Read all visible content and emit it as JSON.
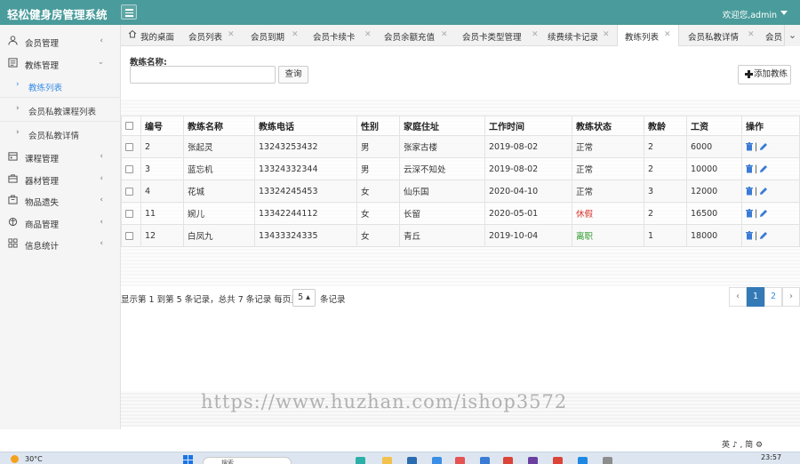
{
  "app": {
    "title": "轻松健身房管理系统",
    "welcome": "欢迎您,admin"
  },
  "sidebar": {
    "items": [
      {
        "label": "会员管理",
        "icon": "user-icon",
        "expanded": false
      },
      {
        "label": "教练管理",
        "icon": "document-icon",
        "expanded": true
      },
      {
        "label": "课程管理",
        "icon": "calendar-icon",
        "expanded": false
      },
      {
        "label": "器材管理",
        "icon": "briefcase-icon",
        "expanded": false
      },
      {
        "label": "物品遗失",
        "icon": "box-icon",
        "expanded": false
      },
      {
        "label": "商品管理",
        "icon": "gift-icon",
        "expanded": false
      },
      {
        "label": "信息统计",
        "icon": "grid-icon",
        "expanded": false
      }
    ],
    "sub_items": [
      {
        "label": "教练列表",
        "active": true
      },
      {
        "label": "会员私教课程列表",
        "active": false
      },
      {
        "label": "会员私教详情",
        "active": false
      }
    ]
  },
  "tabs": [
    {
      "label": "我的桌面",
      "closable": false,
      "active": false
    },
    {
      "label": "会员列表",
      "closable": true,
      "active": false
    },
    {
      "label": "会员到期",
      "closable": true,
      "active": false
    },
    {
      "label": "会员卡续卡",
      "closable": true,
      "active": false
    },
    {
      "label": "会员余额充值",
      "closable": true,
      "active": false
    },
    {
      "label": "会员卡类型管理",
      "closable": true,
      "active": false
    },
    {
      "label": "续费续卡记录",
      "closable": true,
      "active": false
    },
    {
      "label": "教练列表",
      "closable": true,
      "active": true
    },
    {
      "label": "会员私教详情",
      "closable": true,
      "active": false
    },
    {
      "label": "会员",
      "closable": false,
      "active": false
    }
  ],
  "search": {
    "label": "教练名称:",
    "value": "",
    "placeholder": "",
    "button": "查询"
  },
  "add_button": "添加教练",
  "table": {
    "headers": [
      "编号",
      "教练名称",
      "教练电话",
      "性别",
      "家庭住址",
      "工作时间",
      "教练状态",
      "教龄",
      "工资",
      "操作"
    ],
    "rows": [
      {
        "id": "2",
        "name": "张起灵",
        "phone": "13243253432",
        "gender": "男",
        "address": "张家古楼",
        "start": "2019-08-02",
        "status": "正常",
        "status_color": "#333333",
        "years": "2",
        "salary": "6000"
      },
      {
        "id": "3",
        "name": "蓝忘机",
        "phone": "13324332344",
        "gender": "男",
        "address": "云深不知处",
        "start": "2019-08-02",
        "status": "正常",
        "status_color": "#333333",
        "years": "2",
        "salary": "10000"
      },
      {
        "id": "4",
        "name": "花城",
        "phone": "13324245453",
        "gender": "女",
        "address": "仙乐国",
        "start": "2020-04-10",
        "status": "正常",
        "status_color": "#333333",
        "years": "3",
        "salary": "12000"
      },
      {
        "id": "11",
        "name": "婉儿",
        "phone": "13342244112",
        "gender": "女",
        "address": "长留",
        "start": "2020-05-01",
        "status": "休假",
        "status_color": "#d9342b",
        "years": "2",
        "salary": "16500"
      },
      {
        "id": "12",
        "name": "白凤九",
        "phone": "13433324335",
        "gender": "女",
        "address": "青丘",
        "start": "2019-10-04",
        "status": "离职",
        "status_color": "#2e9a2e",
        "years": "1",
        "salary": "18000"
      }
    ],
    "op_separator": "|"
  },
  "pagination": {
    "info": "显示第 1 到第 5 条记录，总共 7 条记录 每页显示",
    "page_size": "5",
    "suffix": "条记录",
    "prev": "‹",
    "pages": [
      "1",
      "2"
    ],
    "current": "1",
    "next": "›"
  },
  "watermark_url": "https://www.huzhan.com/ishop3572",
  "ime_status": "英 ♪ , 简 ⚙",
  "taskbar": {
    "weather": "30°C",
    "search_placeholder": "搜索",
    "clock": "23:57"
  },
  "colors": {
    "header": "#4a9b9b",
    "active_link": "#3a8ee6",
    "page_active": "#337ab7",
    "status_leave": "#d9342b",
    "status_quit": "#2e9a2e"
  }
}
